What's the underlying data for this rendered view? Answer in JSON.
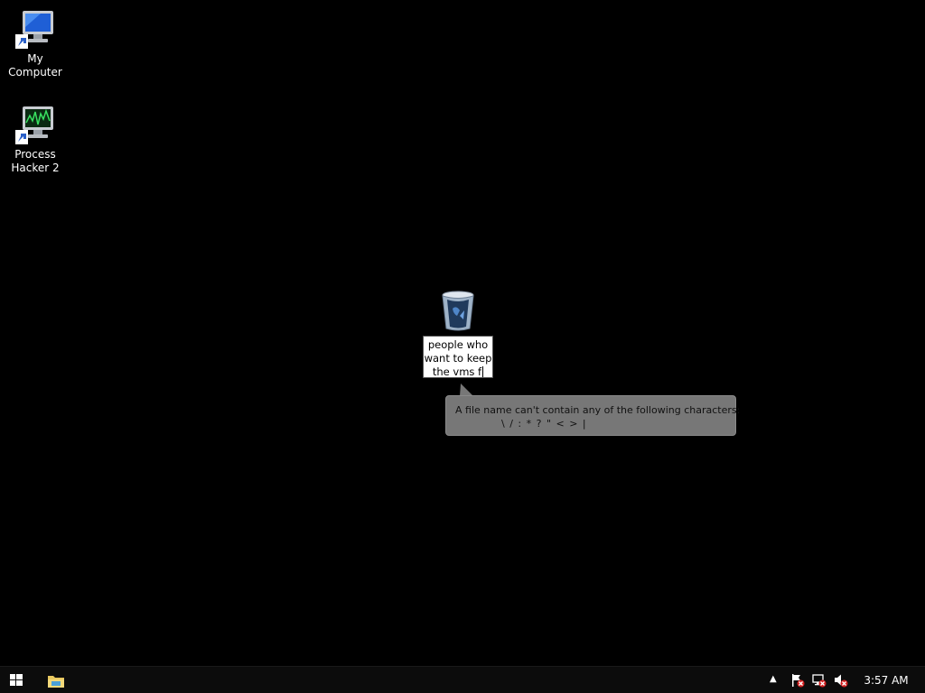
{
  "desktop": {
    "icons": [
      {
        "name": "my-computer",
        "label": "My Computer",
        "icon": "computer-icon"
      },
      {
        "name": "process-hacker",
        "label_line1": "Process",
        "label_line2": "Hacker 2",
        "icon": "process-hacker-icon"
      }
    ],
    "recycle_bin": {
      "icon": "recycle-bin-icon",
      "rename_line1": "people who",
      "rename_line2": "want to keep",
      "rename_line3": "the vms f"
    },
    "balloon": {
      "line1": "A file name can't contain any of the following characters:",
      "line2": "\\ / : * ? \" < > |"
    }
  },
  "taskbar": {
    "start_icon": "windows-logo-icon",
    "pinned": [
      {
        "icon": "file-explorer-icon"
      }
    ],
    "tray": {
      "chevron": "▲",
      "icons": [
        "action-center-flag-icon",
        "network-icon",
        "volume-muted-icon"
      ],
      "clock": "3:57 AM"
    }
  },
  "colors": {
    "desktop_bg": "#000000",
    "taskbar_bg": "#0c0c0c",
    "balloon_bg": "#777777",
    "error_badge": "#d42020"
  }
}
